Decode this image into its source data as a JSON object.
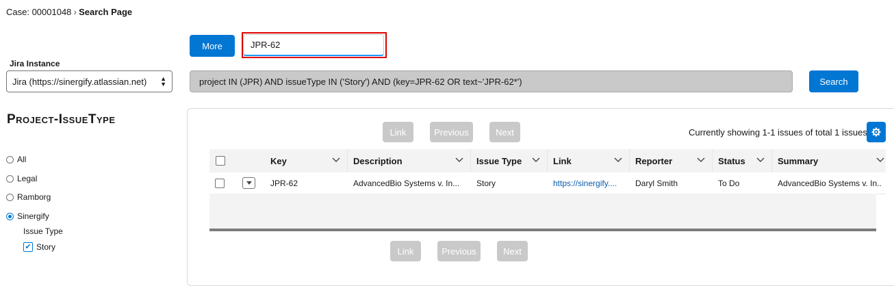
{
  "breadcrumb": {
    "case": "Case: 00001048",
    "current": "Search Page"
  },
  "toolbar": {
    "more_label": "More",
    "search_value": "JPR-62",
    "search_label": "Search"
  },
  "jira": {
    "label": "Jira Instance",
    "selected": "Jira (https://sinergify.atlassian.net)"
  },
  "jql": "project IN (JPR) AND issueType IN ('Story') AND (key=JPR-62 OR text~'JPR-62*')",
  "sidebar": {
    "heading": "Project-IssueType",
    "projects": [
      {
        "label": "All",
        "checked": false
      },
      {
        "label": "Legal",
        "checked": false
      },
      {
        "label": "Ramborg",
        "checked": false
      },
      {
        "label": "Sinergify",
        "checked": true
      }
    ],
    "issue_type_label": "Issue Type",
    "issue_types": [
      {
        "label": "Story",
        "checked": true
      }
    ]
  },
  "pagination": {
    "link": "Link",
    "previous": "Previous",
    "next": "Next"
  },
  "showing_text": "Currently showing 1-1 issues of total 1 issues",
  "table": {
    "columns": [
      "Key",
      "Description",
      "Issue Type",
      "Link",
      "Reporter",
      "Status",
      "Summary"
    ],
    "rows": [
      {
        "key": "JPR-62",
        "description": "AdvancedBio Systems v. In...",
        "issue_type": "Story",
        "link": "https://sinergify....",
        "reporter": "Daryl Smith",
        "status": "To Do",
        "summary": "AdvancedBio Systems v. In..."
      }
    ]
  },
  "colors": {
    "brand": "#0176d3",
    "highlight": "#e00000",
    "disabled": "#c9c9c9"
  }
}
